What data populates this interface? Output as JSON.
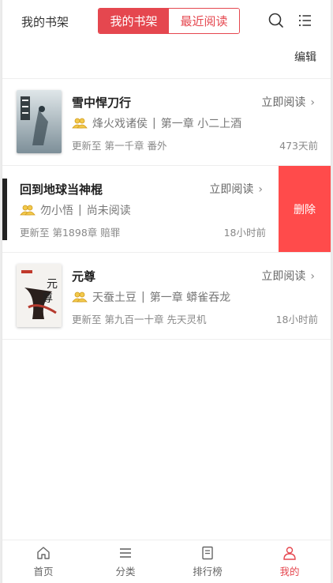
{
  "header": {
    "title": "我的书架",
    "segments": [
      {
        "label": "我的书架",
        "active": true
      },
      {
        "label": "最近阅读",
        "active": false
      }
    ],
    "icons": [
      "search-icon",
      "menu-list-icon"
    ]
  },
  "toolbar": {
    "edit_label": "编辑"
  },
  "books": [
    {
      "title": "雪中悍刀行",
      "read_label": "立即阅读",
      "author": "烽火戏诸侯",
      "chapter": "第一章 小二上酒",
      "update": "更新至 第一千章 番外",
      "time": "473天前"
    },
    {
      "title": "回到地球当神棍",
      "read_label": "立即阅读",
      "author": "勿小悟",
      "chapter": "尚未阅读",
      "update": "更新至 第1898章 赔罪",
      "time": "18小时前",
      "delete_label": "删除"
    },
    {
      "title": "元尊",
      "read_label": "立即阅读",
      "author": "天蚕土豆",
      "chapter": "第一章 蟒雀吞龙",
      "update": "更新至 第九百一十章 先天灵机",
      "time": "18小时前"
    }
  ],
  "tabs": [
    {
      "label": "首页",
      "icon": "home-icon",
      "active": false
    },
    {
      "label": "分类",
      "icon": "category-icon",
      "active": false
    },
    {
      "label": "排行榜",
      "icon": "ranking-icon",
      "active": false
    },
    {
      "label": "我的",
      "icon": "user-icon",
      "active": true
    }
  ],
  "colors": {
    "accent": "#e5474f",
    "delete": "#ff4b4b"
  }
}
